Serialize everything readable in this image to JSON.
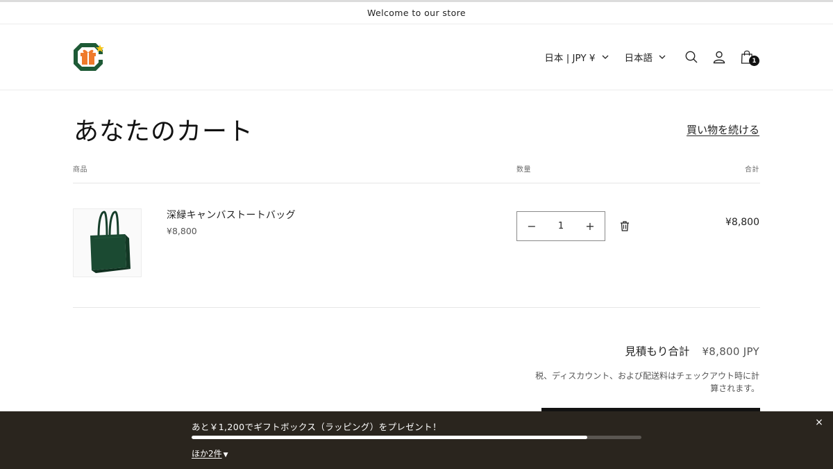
{
  "announcement": {
    "text": "Welcome to our store"
  },
  "header": {
    "logo_icon": "gift-box-logo",
    "country_selector": "日本 | JPY ¥",
    "language_selector": "日本語",
    "search_icon": "search-icon",
    "account_icon": "user-icon",
    "cart_icon": "shopping-bag-icon",
    "cart_count": "1"
  },
  "cart": {
    "title": "あなたのカート",
    "continue_shopping": "買い物を続ける",
    "columns": {
      "product": "商品",
      "quantity": "数量",
      "total": "合計"
    },
    "items": [
      {
        "name": "深緑キャンバストートバッグ",
        "price": "¥8,800",
        "quantity": "1",
        "line_total": "¥8,800",
        "decrease_label": "−",
        "increase_label": "+"
      }
    ],
    "subtotal_label": "見積もり合計",
    "subtotal_value": "¥8,800 JPY",
    "tax_note": "税、ディスカウント、および配送料はチェックアウト時に計算されます。"
  },
  "promo_bar": {
    "message": "あと￥1,200でギフトボックス（ラッピング）をプレゼント！",
    "progress_fraction": 0.88,
    "more_link": "ほか2件",
    "close_label": "×"
  },
  "colors": {
    "brand_green": "#1e5a36",
    "brand_orange": "#ef7a2b",
    "promo_bg": "#2a251e",
    "tote_green": "#173f2b"
  }
}
